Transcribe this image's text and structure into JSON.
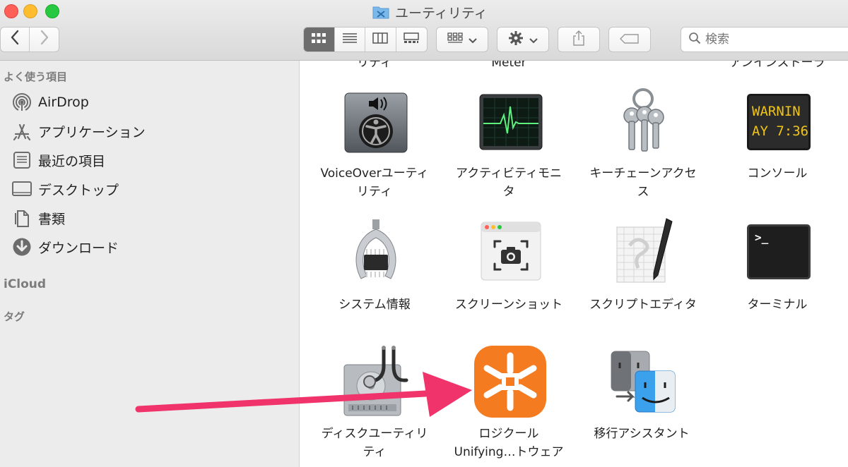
{
  "window": {
    "title": "ユーティリティ"
  },
  "toolbar": {
    "search_placeholder": "検索",
    "back_icon": "chevron-left-icon",
    "forward_icon": "chevron-right-icon"
  },
  "sidebar": {
    "favorites_header": "よく使う項目",
    "items": [
      {
        "label": "AirDrop",
        "icon": "airdrop-icon"
      },
      {
        "label": "アプリケーション",
        "icon": "applications-icon"
      },
      {
        "label": "最近の項目",
        "icon": "recents-icon"
      },
      {
        "label": "デスクトップ",
        "icon": "desktop-icon"
      },
      {
        "label": "書類",
        "icon": "documents-icon"
      },
      {
        "label": "ダウンロード",
        "icon": "downloads-icon"
      }
    ],
    "icloud_header": "iCloud",
    "tags_header": "タグ"
  },
  "files": {
    "partial_top": [
      "リティ",
      "Meter",
      "アンインストーラ"
    ],
    "row1": [
      "VoiceOverユーティ",
      "リティ",
      "アクティビティモニ",
      "タ",
      "キーチェーンアクセ",
      "ス",
      "コンソール"
    ],
    "row2": [
      "システム情報",
      "スクリーンショット",
      "スクリプトエディタ",
      "ターミナル"
    ],
    "row3": [
      "ディスクユーティリ",
      "ティ",
      "ロジクール",
      "Unifying…トウェア",
      "移行アシスタント"
    ],
    "console_text": [
      "WARNIN",
      "AY 7:36"
    ]
  },
  "colors": {
    "arrow": "#f0336a",
    "logi_orange": "#f47b20",
    "accent": "#6d6d6d"
  }
}
